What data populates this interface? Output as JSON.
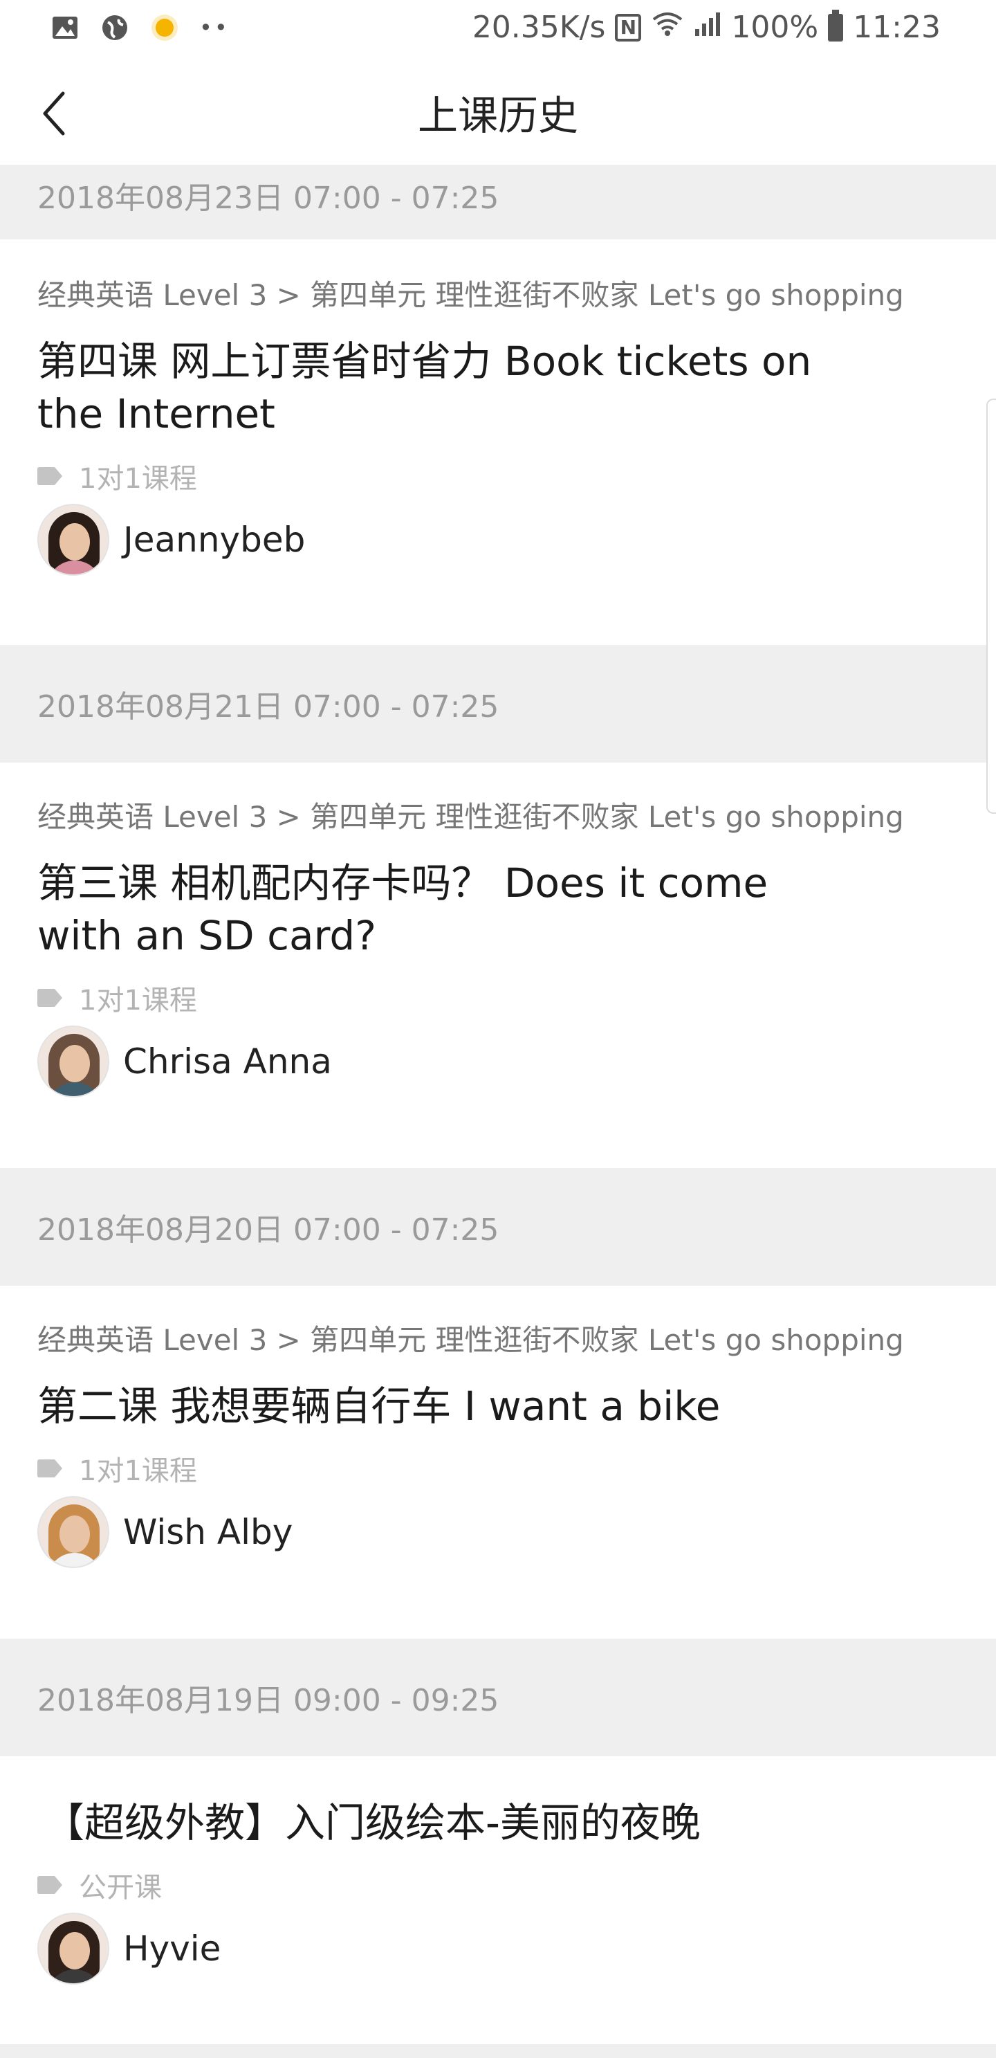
{
  "status_bar": {
    "speed": "20.35K/s",
    "battery": "100%",
    "time": "11:23",
    "icons": [
      "image-icon",
      "globe-icon",
      "sun-icon",
      "more-dots-icon",
      "nfc-icon",
      "wifi-icon",
      "signal-icon",
      "battery-icon"
    ]
  },
  "header": {
    "title": "上课历史"
  },
  "lessons": [
    {
      "date": "2018年08月23日 07:00 - 07:25",
      "breadcrumb": "经典英语 Level 3 > 第四单元 理性逛街不败家 Let's go shopping",
      "title": "第四课 网上订票省时省力 Book tickets on the Internet",
      "tag": "1对1课程",
      "teacher": "Jeannybeb"
    },
    {
      "date": "2018年08月21日 07:00 - 07:25",
      "breadcrumb": "经典英语 Level 3 > 第四单元 理性逛街不败家 Let's go shopping",
      "title": "第三课 相机配内存卡吗？ Does it come with an SD card?",
      "tag": "1对1课程",
      "teacher": "Chrisa Anna"
    },
    {
      "date": "2018年08月20日 07:00 - 07:25",
      "breadcrumb": "经典英语 Level 3 > 第四单元 理性逛街不败家 Let's go shopping",
      "title": "第二课 我想要辆自行车 I want a bike",
      "tag": "1对1课程",
      "teacher": "Wish Alby"
    },
    {
      "date": "2018年08月19日 09:00 - 09:25",
      "title": "【超级外教】入门级绘本-美丽的夜晚",
      "tag": "公开课",
      "teacher": "Hyvie"
    }
  ]
}
